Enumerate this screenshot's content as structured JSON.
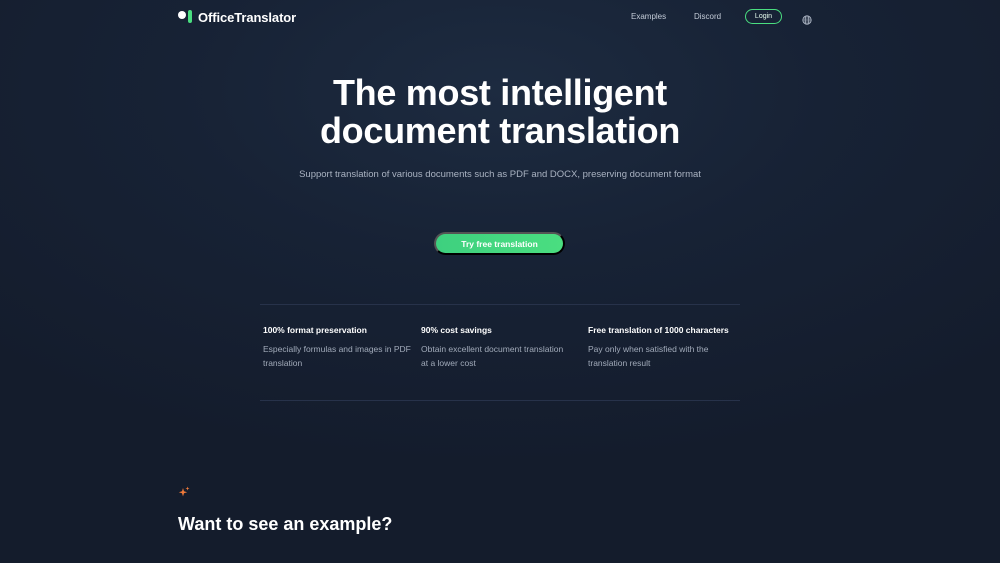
{
  "nav": {
    "brand": "OfficeTranslator",
    "links": [
      "Examples",
      "Discord"
    ],
    "login_label": "Login",
    "icons": {
      "logo": "logo-mark-icon",
      "language": "globe-icon"
    }
  },
  "hero": {
    "title_line1": "The most intelligent",
    "title_line2": "document translation",
    "subtitle": "Support translation of various documents such as PDF and DOCX, preserving document format",
    "cta_label": "Try free translation"
  },
  "features": [
    {
      "title": "100% format preservation",
      "desc": "Especially formulas and images in PDF translation"
    },
    {
      "title": "90% cost savings",
      "desc": "Obtain excellent document translation at a lower cost"
    },
    {
      "title": "Free translation of 1000 characters",
      "desc": "Pay only when satisfied with the translation result"
    }
  ],
  "example_section": {
    "icon": "sparkle-icon",
    "title": "Want to see an example?"
  },
  "colors": {
    "accent": "#4ade80",
    "background": "#151d2d",
    "text_muted": "#a2abba"
  }
}
